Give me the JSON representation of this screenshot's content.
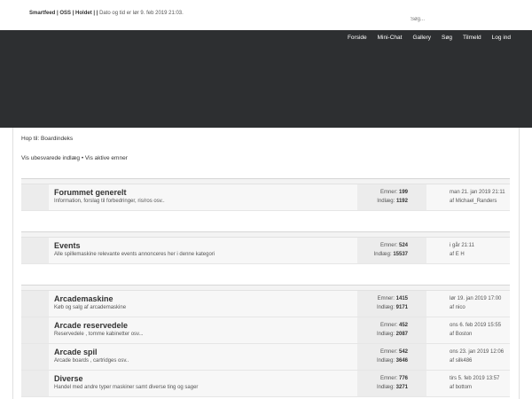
{
  "topbar": {
    "links_text": "Smartfeed | OSS | Holdet | |",
    "date_text": "Dato og tid er lør 9. feb 2019 21:03.",
    "search_placeholder": "Søg..."
  },
  "nav": {
    "items": [
      "Forside",
      "Mini-Chat",
      "Gallery",
      "Søg",
      "Tilmeld",
      "Log ind"
    ]
  },
  "breadcrumb": {
    "prefix": "Hop til:",
    "link": "Boardindeks"
  },
  "quicklinks": {
    "unanswered": "Vis ubesvarede indlæg",
    "separator": "•",
    "active": "Vis aktive emner"
  },
  "labels": {
    "topics": "Emner:",
    "posts": "Indlæg:",
    "by": "af"
  },
  "groups": [
    {
      "forums": [
        {
          "title": "Forummet generelt",
          "desc": "Information, forslag til forbedringer, ris/ros osv..",
          "topics": "199",
          "posts": "1192",
          "last_date": "man 21. jan 2019 21:11",
          "last_user": "Michael_Randers"
        }
      ]
    },
    {
      "forums": [
        {
          "title": "Events",
          "desc": "Alle spillemaskine relevante events annonceres her i denne kategori",
          "topics": "524",
          "posts": "15537",
          "last_date": "i går 21:11",
          "last_user": "E H"
        }
      ]
    },
    {
      "forums": [
        {
          "title": "Arcademaskine",
          "desc": "Køb og salg af arcademaskine",
          "topics": "1415",
          "posts": "9171",
          "last_date": "lør 19. jan 2019 17:00",
          "last_user": "nico"
        },
        {
          "title": "Arcade reservedele",
          "desc": "Reservedele , tomme kabinetter osv...",
          "topics": "452",
          "posts": "2087",
          "last_date": "ons 6. feb 2019 15:55",
          "last_user": "Boston"
        },
        {
          "title": "Arcade spil",
          "desc": "Arcade boards , cartridges osv..",
          "topics": "542",
          "posts": "3646",
          "last_date": "ons 23. jan 2019 12:06",
          "last_user": "silk486"
        },
        {
          "title": "Diverse",
          "desc": "Handel med andre typer maskiner samt diverse ting og sager",
          "topics": "776",
          "posts": "3271",
          "last_date": "tirs 5. feb 2019 13:57",
          "last_user": "bottom"
        }
      ]
    }
  ]
}
